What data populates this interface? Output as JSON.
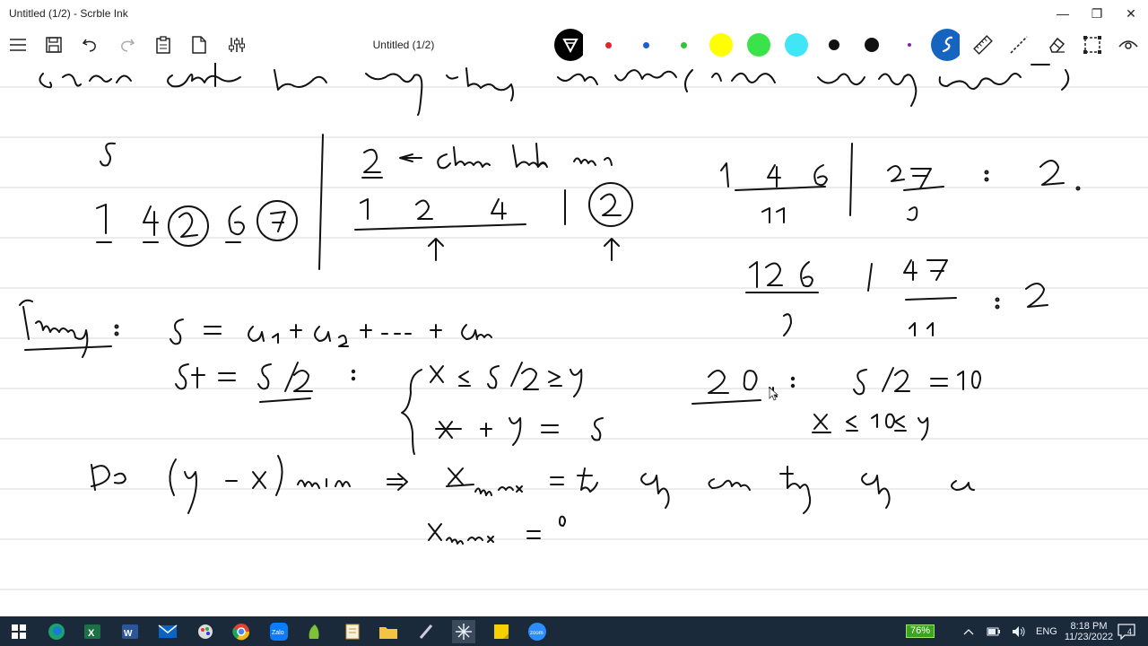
{
  "window": {
    "title": "Untitled (1/2) - Scrble Ink",
    "doc_title": "Untitled (1/2)",
    "minimize_glyph": "—",
    "maximize_glyph": "❐",
    "close_glyph": "✕"
  },
  "toolbar": {
    "icons": [
      "hamburger-menu-icon",
      "save-icon",
      "undo-icon",
      "redo-icon",
      "paste-icon",
      "new-page-icon",
      "settings-sliders-icon"
    ],
    "pens": [
      {
        "name": "pen-black-filter",
        "color": "#000000",
        "kind": "filter"
      },
      {
        "name": "pen-red",
        "color": "#e3242b",
        "kind": "small"
      },
      {
        "name": "pen-blue",
        "color": "#1e5bd6",
        "kind": "small"
      },
      {
        "name": "pen-green",
        "color": "#33c433",
        "kind": "small"
      },
      {
        "name": "highlighter-yellow",
        "color": "#ffff00",
        "kind": "large"
      },
      {
        "name": "highlighter-green",
        "color": "#3be34a",
        "kind": "large"
      },
      {
        "name": "highlighter-cyan",
        "color": "#40e6f5",
        "kind": "large"
      },
      {
        "name": "pen-black-medium",
        "color": "#111111",
        "kind": "medium"
      },
      {
        "name": "pen-black-large",
        "color": "#111111",
        "kind": "large2"
      },
      {
        "name": "pen-purple",
        "color": "#7a2aa8",
        "kind": "tiny"
      },
      {
        "name": "pen-blue-active",
        "color": "#1565c0",
        "kind": "active"
      }
    ],
    "right_icons": [
      "ruler-icon",
      "line-tool-icon",
      "eraser-icon",
      "lasso-select-icon",
      "eye-icon"
    ]
  },
  "accent_color": "#1565c0",
  "taskbar": {
    "apps": [
      "windows-start-icon",
      "edge-icon",
      "excel-icon",
      "word-icon",
      "mail-icon",
      "paint-icon",
      "chrome-icon",
      "zalo-icon",
      "notepad-plus-icon",
      "script-icon",
      "file-explorer-icon",
      "pen-icon",
      "scrble-ink-icon",
      "sticky-notes-icon",
      "zoom-icon"
    ],
    "battery": "76%",
    "language": "ENG",
    "time": "8:18 PM",
    "date": "11/23/2022",
    "notifications": "4"
  }
}
